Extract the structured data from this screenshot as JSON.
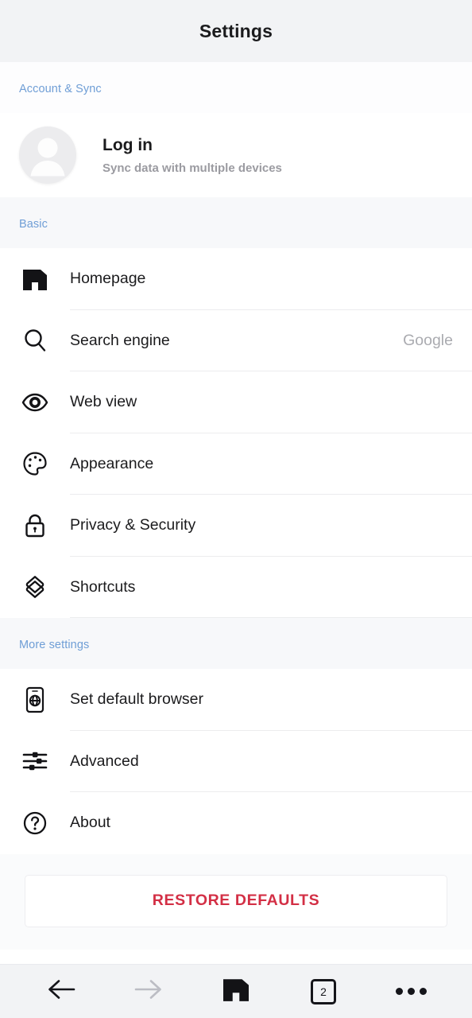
{
  "header": {
    "title": "Settings"
  },
  "sections": [
    {
      "id": "account",
      "title": "Account & Sync"
    },
    {
      "id": "basic",
      "title": "Basic"
    },
    {
      "id": "more",
      "title": "More settings"
    }
  ],
  "account": {
    "avatar_icon": "person-avatar-icon",
    "title": "Log in",
    "subtitle": "Sync data with multiple devices"
  },
  "basic_rows": [
    {
      "icon": "maxthon-logo-icon",
      "label": "Homepage",
      "value": ""
    },
    {
      "icon": "search-icon",
      "label": "Search engine",
      "value": "Google"
    },
    {
      "icon": "eye-icon",
      "label": "Web view",
      "value": ""
    },
    {
      "icon": "palette-icon",
      "label": "Appearance",
      "value": ""
    },
    {
      "icon": "lock-icon",
      "label": "Privacy & Security",
      "value": ""
    },
    {
      "icon": "shortcuts-icon",
      "label": "Shortcuts",
      "value": ""
    }
  ],
  "more_rows": [
    {
      "icon": "phone-globe-icon",
      "label": "Set default browser",
      "value": ""
    },
    {
      "icon": "sliders-icon",
      "label": "Advanced",
      "value": ""
    },
    {
      "icon": "question-circle-icon",
      "label": "About",
      "value": ""
    }
  ],
  "restore": {
    "label": "RESTORE DEFAULTS",
    "color": "#d32f45"
  },
  "bottombar": {
    "back_icon": "arrow-left-icon",
    "forward_icon": "arrow-right-icon",
    "home_icon": "maxthon-logo-icon",
    "tab_count": "2",
    "menu_icon": "more-horizontal-icon"
  },
  "colors": {
    "header_bg": "#f2f3f5",
    "section_label": "#6f9ed6",
    "value_text": "#aaabb0",
    "accent_red": "#d32f45"
  }
}
